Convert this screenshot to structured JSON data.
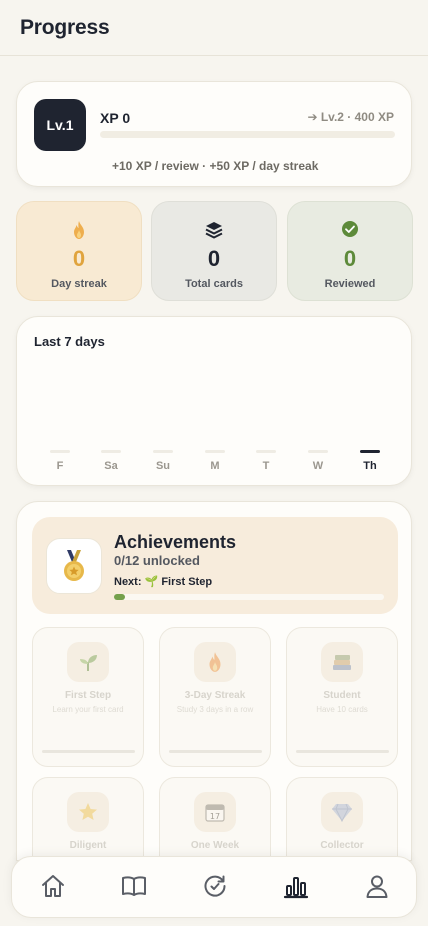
{
  "header": {
    "title": "Progress"
  },
  "level": {
    "badge": "Lv.1",
    "xp_label": "XP 0",
    "next_level": "➔ Lv.2 · 400 XP",
    "xp_fraction": 0,
    "rules": "+10 XP / review · +50 XP / day streak"
  },
  "stats": [
    {
      "value": "0",
      "label": "Day streak",
      "icon": "flame-icon"
    },
    {
      "value": "0",
      "label": "Total cards",
      "icon": "stack-icon"
    },
    {
      "value": "0",
      "label": "Reviewed",
      "icon": "check-circle-icon"
    }
  ],
  "weekly": {
    "title": "Last 7 days",
    "days": [
      "F",
      "Sa",
      "Su",
      "M",
      "T",
      "W",
      "Th"
    ],
    "today_index": 6
  },
  "achievements": {
    "title": "Achievements",
    "count": "0/12 unlocked",
    "next": "Next: 🌱 First Step",
    "progress_fraction": 0.04,
    "items": [
      {
        "name": "First Step",
        "desc": "Learn your first card",
        "icon": "sprout-icon"
      },
      {
        "name": "3-Day Streak",
        "desc": "Study 3 days in a row",
        "icon": "flame-icon"
      },
      {
        "name": "Student",
        "desc": "Have 10 cards",
        "icon": "books-icon"
      },
      {
        "name": "Diligent",
        "desc": "",
        "icon": "star-icon"
      },
      {
        "name": "One Week",
        "desc": "",
        "icon": "calendar-icon"
      },
      {
        "name": "Collector",
        "desc": "",
        "icon": "gem-icon"
      }
    ]
  },
  "nav": {
    "items": [
      "home-icon",
      "book-icon",
      "review-icon",
      "stats-icon",
      "profile-icon"
    ],
    "active_index": 3
  },
  "colors": {
    "accent_dark": "#1f2430",
    "green": "#5d8a3a",
    "amber": "#e0a43e"
  }
}
